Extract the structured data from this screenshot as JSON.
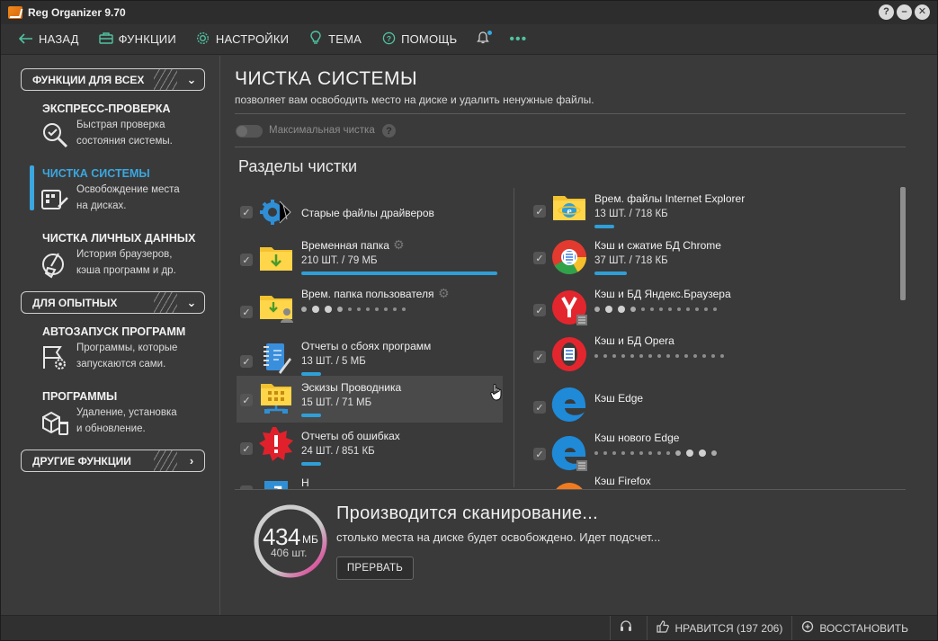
{
  "window": {
    "title": "Reg Organizer 9.70",
    "controls": [
      "?",
      "–",
      "✕"
    ]
  },
  "menu": {
    "back": "НАЗАД",
    "functions": "ФУНКЦИИ",
    "settings": "НАСТРОЙКИ",
    "theme": "ТЕМА",
    "help": "ПОМОЩЬ",
    "more": "•••"
  },
  "sidebar": {
    "groups": [
      {
        "label": "ФУНКЦИИ ДЛЯ ВСЕХ"
      },
      {
        "label": "ДЛЯ ОПЫТНЫХ"
      },
      {
        "label": "ДРУГИЕ ФУНКЦИИ"
      }
    ],
    "items": [
      {
        "title": "ЭКСПРЕСС-ПРОВЕРКА",
        "desc1": "Быстрая проверка",
        "desc2": "состояния системы."
      },
      {
        "title": "ЧИСТКА СИСТЕМЫ",
        "desc1": "Освобождение места",
        "desc2": "на дисках."
      },
      {
        "title": "ЧИСТКА ЛИЧНЫХ ДАННЫХ",
        "desc1": "История браузеров,",
        "desc2": "кэша программ и др."
      },
      {
        "title": "АВТОЗАПУСК ПРОГРАММ",
        "desc1": "Программы, которые",
        "desc2": "запускаются сами."
      },
      {
        "title": "ПРОГРАММЫ",
        "desc1": "Удаление, установка",
        "desc2": "и обновление."
      }
    ]
  },
  "main": {
    "title": "ЧИСТКА СИСТЕМЫ",
    "subtitle": "позволяет вам освободить место на диске и удалить ненужные файлы.",
    "toggle_label": "Максимальная чистка",
    "help": "?",
    "section_title": "Разделы чистки",
    "left_items": [
      {
        "name": "Старые файлы драйверов",
        "stats": ""
      },
      {
        "name": "Временная папка",
        "stats": "210 ШТ. / 79 МБ",
        "progress": 1.0
      },
      {
        "name": "Врем. папка пользователя",
        "stats": ""
      },
      {
        "name": "Отчеты о сбоях программ",
        "stats": "13 ШТ. / 5 МБ",
        "progress": 0.1
      },
      {
        "name": "Эскизы Проводника",
        "stats": "15 ШТ. / 71 МБ",
        "progress": 0.1
      },
      {
        "name": "Отчеты об ошибках",
        "stats": "24 ШТ. / 851 КБ",
        "progress": 0.1
      },
      {
        "name": "Н",
        "stats": ""
      }
    ],
    "right_items": [
      {
        "name": "Врем. файлы Internet Explorer",
        "stats": "13 ШТ. / 718 КБ",
        "progress": 0.1
      },
      {
        "name": "Кэш и сжатие БД Chrome",
        "stats": "37 ШТ. / 718 КБ",
        "progress": 0.1
      },
      {
        "name": "Кэш и БД Яндекс.Браузера",
        "stats": ""
      },
      {
        "name": "Кэш и БД Opera",
        "stats": ""
      },
      {
        "name": "Кэш Edge",
        "stats": ""
      },
      {
        "name": "Кэш нового Edge",
        "stats": ""
      },
      {
        "name": "Кэш Firefox",
        "stats": ""
      }
    ]
  },
  "scan": {
    "size": "434",
    "unit": "МБ",
    "count": "406 шт.",
    "title": "Производится сканирование...",
    "desc": "столько места на диске будет освобождено. Идет подсчет...",
    "stop": "ПРЕРВАТЬ"
  },
  "status": {
    "like": "НРАВИТСЯ (197 206)",
    "restore": "ВОССТАНОВИТЬ"
  },
  "colors": {
    "accent": "#3aa7e0",
    "teal": "#4fc3a1",
    "bg": "#3a3a3a"
  }
}
